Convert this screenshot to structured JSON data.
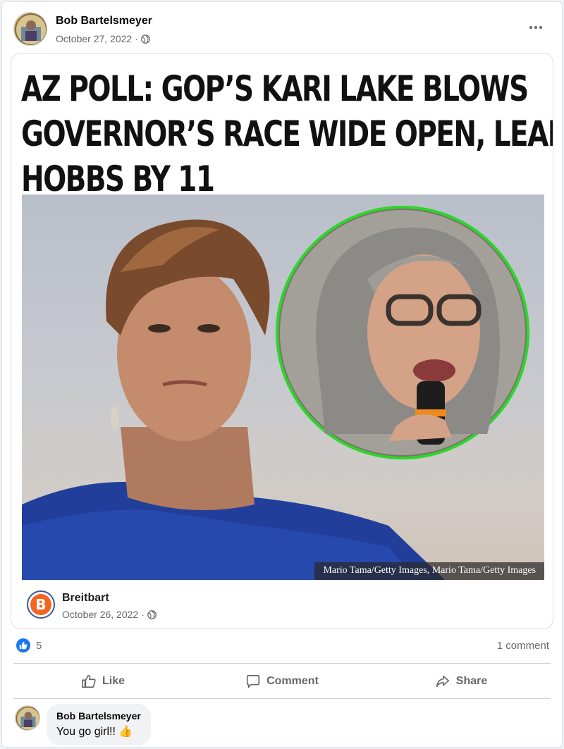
{
  "post": {
    "author": "Bob Bartelsmeyer",
    "date": "October 27, 2022",
    "audience_icon": "globe-icon",
    "more_icon": "more-options-icon"
  },
  "link_card": {
    "headline_lines": [
      "AZ POLL: GOP’S KARI LAKE BLOWS",
      "GOVERNOR’S RACE WIDE OPEN, LEADS",
      "HOBBS BY 11"
    ],
    "photo_credit": "Mario Tama/Getty Images, Mario Tama/Getty Images",
    "source_name": "Breitbart",
    "source_logo_letter": "B",
    "source_date": "October 26, 2022"
  },
  "reactions": {
    "count": "5",
    "comments": "1 comment"
  },
  "actions": {
    "like": "Like",
    "comment": "Comment",
    "share": "Share"
  },
  "comment": {
    "author": "Bob Bartelsmeyer",
    "text": "You go girl!! 👍"
  },
  "colors": {
    "brand_blue": "#1877f2",
    "breitbart_orange": "#f26522",
    "ring_green": "#22d422"
  }
}
